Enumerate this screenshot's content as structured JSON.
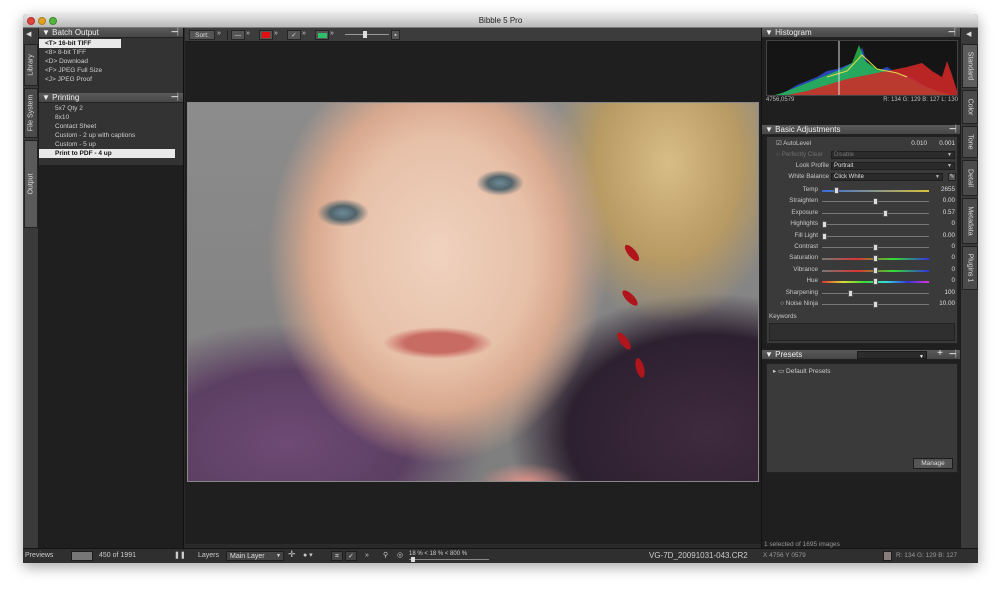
{
  "window": {
    "title": "Bibble 5 Pro"
  },
  "left_tabs": [
    "Library",
    "File System",
    "Output"
  ],
  "right_tabs": [
    "Standard",
    "Color",
    "Tone",
    "Detail",
    "Metadata",
    "Plugins 1"
  ],
  "batch_output": {
    "title": "Batch Output",
    "items": [
      "<T>  16-bit TIFF",
      "<8>  8-bit TIFF",
      "<D>  Download",
      "<F>  JPEG Full Size",
      "<J>  JPEG Proof"
    ]
  },
  "printing": {
    "title": "Printing",
    "items": [
      "5x7 Qty 2",
      "8x10",
      "Contact Sheet",
      "Custom - 2 up with captions",
      "Custom - 5 up",
      "Print to PDF - 4 up"
    ]
  },
  "toolbar": {
    "sort_label": "Sort:"
  },
  "histogram": {
    "title": "Histogram",
    "coords": "4756,0579",
    "rgb": "R: 134  G: 129  B: 127  L: 130"
  },
  "basic_adjustments": {
    "title": "Basic Adjustments",
    "autolevel_label": "AutoLevel",
    "autolevel_v1": "0.010",
    "autolevel_v2": "0.001",
    "perfectly_clear_label": "Perfectly Clear",
    "perfectly_clear_value": "Disable",
    "look_profile_label": "Look Profile",
    "look_profile_value": "Portrait",
    "white_balance_label": "White Balance",
    "white_balance_value": "Click White",
    "sliders": [
      {
        "label": "Temp",
        "value": "2655",
        "pos": 0.12
      },
      {
        "label": "Straighten",
        "value": "0.00",
        "pos": 0.5
      },
      {
        "label": "Exposure",
        "value": "0.57",
        "pos": 0.6
      },
      {
        "label": "Highlights",
        "value": "0",
        "pos": 0.0
      },
      {
        "label": "Fill Light",
        "value": "0.00",
        "pos": 0.0
      },
      {
        "label": "Contrast",
        "value": "0",
        "pos": 0.5
      },
      {
        "label": "Saturation",
        "value": "0",
        "pos": 0.5
      },
      {
        "label": "Vibrance",
        "value": "0",
        "pos": 0.5
      },
      {
        "label": "Hue",
        "value": "0",
        "pos": 0.5
      },
      {
        "label": "Sharpening",
        "value": "100",
        "pos": 0.25
      },
      {
        "label": "Noise Ninja",
        "value": "10.00",
        "pos": 0.5
      }
    ],
    "keywords_label": "Keywords"
  },
  "presets": {
    "title": "Presets",
    "default_item": "Default Presets",
    "manage_label": "Manage"
  },
  "status": {
    "selection": "1 selected of 1695 images",
    "coords": "X  4756  Y  0579",
    "rgb": "R: 134  G: 129  B: 127"
  },
  "bottom": {
    "previews_label": "Previews",
    "count": "450 of 1991",
    "layers_label": "Layers",
    "layer_value": "Main Layer",
    "zoom": "18 % < 18 % < 800 %",
    "filename": "VG-7D_20091031-043.CR2"
  }
}
